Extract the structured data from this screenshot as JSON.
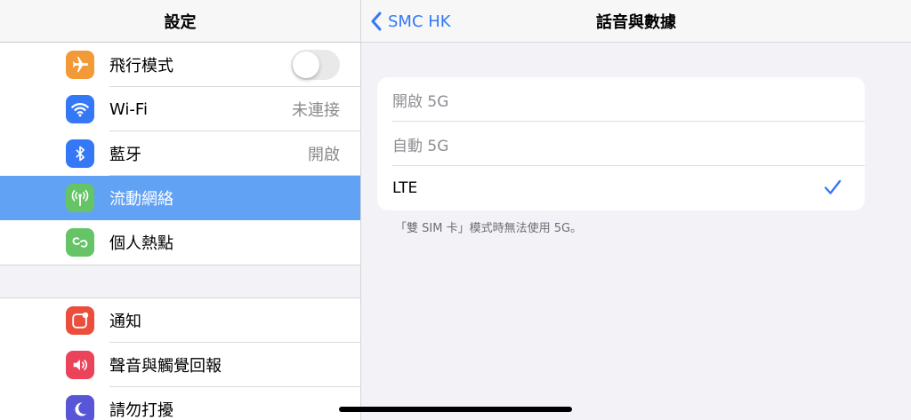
{
  "sidebar": {
    "title": "設定",
    "group1": [
      {
        "label": "飛行模式",
        "icon": "airplane-icon",
        "color": "#f19a37",
        "control": "toggle",
        "toggle_on": false
      },
      {
        "label": "Wi-Fi",
        "icon": "wifi-icon",
        "color": "#3478f6",
        "value": "未連接"
      },
      {
        "label": "藍牙",
        "icon": "bluetooth-icon",
        "color": "#3478f6",
        "value": "開啟"
      },
      {
        "label": "流動網絡",
        "icon": "cellular-antenna-icon",
        "color": "#65c466",
        "selected": true
      },
      {
        "label": "個人熱點",
        "icon": "hotspot-link-icon",
        "color": "#65c466"
      }
    ],
    "group2": [
      {
        "label": "通知",
        "icon": "notifications-icon",
        "color": "#eb4e3d"
      },
      {
        "label": "聲音與觸覺回報",
        "icon": "speaker-icon",
        "color": "#eb445a"
      },
      {
        "label": "請勿打擾",
        "icon": "moon-icon",
        "color": "#5856d6"
      }
    ]
  },
  "detail": {
    "back_label": "SMC HK",
    "title": "話音與數據",
    "options": [
      {
        "label": "開啟 5G",
        "disabled": true,
        "checked": false
      },
      {
        "label": "自動 5G",
        "disabled": true,
        "checked": false
      },
      {
        "label": "LTE",
        "disabled": false,
        "checked": true
      }
    ],
    "footnote": "「雙 SIM 卡」模式時無法使用 5G。"
  },
  "colors": {
    "accent": "#3478f6",
    "selected_row": "#62a2f4",
    "background": "#f2f2f7"
  }
}
